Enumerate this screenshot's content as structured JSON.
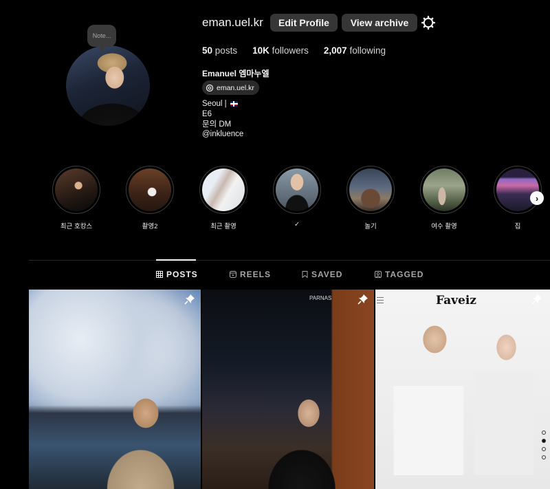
{
  "profile": {
    "note": "Note...",
    "username": "eman.uel.kr",
    "edit_profile": "Edit Profile",
    "view_archive": "View archive",
    "posts_count": "50",
    "posts_label": "posts",
    "followers_count": "10K",
    "followers_label": "followers",
    "following_count": "2,007",
    "following_label": "following",
    "full_name": "Emanuel 엠마누엘",
    "threads_handle": "eman.uel.kr",
    "bio": [
      "Seoul |",
      "E6",
      "문의 DM",
      "@inkluence"
    ]
  },
  "highlights": [
    {
      "label": "최근 호캉스"
    },
    {
      "label": "촬영2"
    },
    {
      "label": "최근 촬영"
    },
    {
      "label": "✓"
    },
    {
      "label": "놀기"
    },
    {
      "label": "여수 촬영"
    },
    {
      "label": "집"
    }
  ],
  "tabs": [
    {
      "label": "POSTS",
      "active": true
    },
    {
      "label": "REELS",
      "active": false
    },
    {
      "label": "SAVED",
      "active": false
    },
    {
      "label": "TAGGED",
      "active": false
    }
  ],
  "posts": [
    {
      "pinned": true
    },
    {
      "pinned": true,
      "sign": "PARNAS"
    },
    {
      "pinned": true,
      "brand": "Faveiz",
      "carousel_index": 1,
      "carousel_total": 4
    }
  ],
  "colors": {
    "background": "#000000",
    "button": "#363636",
    "text": "#f5f5f5",
    "muted": "#a8a8a8"
  }
}
